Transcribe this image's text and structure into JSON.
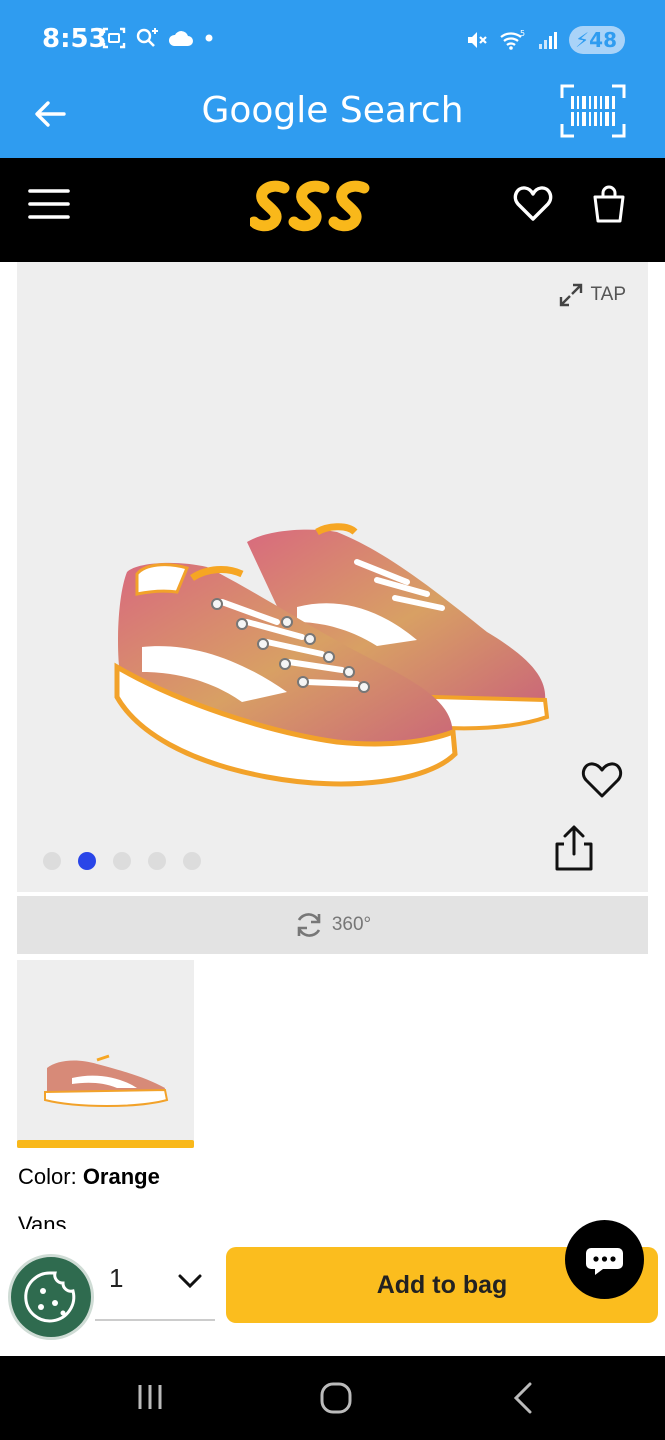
{
  "status_bar": {
    "time": "8:53",
    "battery": "48"
  },
  "app_header": {
    "title": "Google Search"
  },
  "product": {
    "tap_label": "TAP",
    "spin_label": "360°",
    "carousel": {
      "count": 5,
      "active_index": 1
    },
    "color_label": "Color:",
    "color_value": "Orange",
    "brand": "Vans"
  },
  "purchase": {
    "quantity": "1",
    "add_to_bag_label": "Add to bag"
  },
  "colors": {
    "accent_blue": "#2f9cf0",
    "brand_yellow": "#fbbd1e",
    "active_dot": "#2945e8"
  }
}
